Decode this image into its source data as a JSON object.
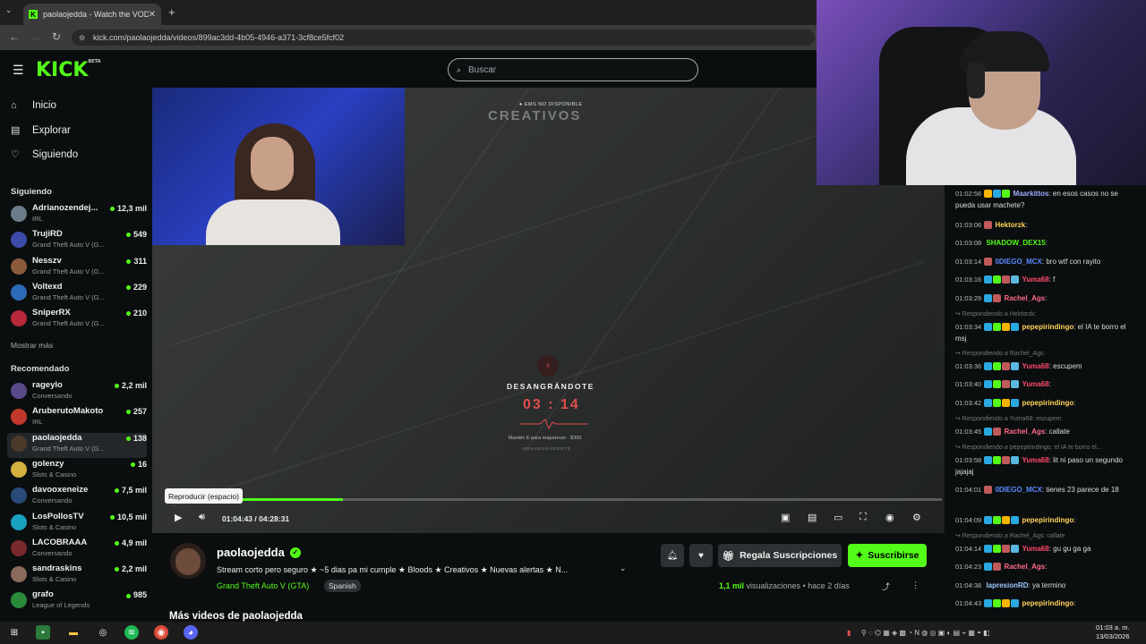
{
  "browser": {
    "tab_title": "paolaojedda - Watch the VOD o",
    "url": "kick.com/paolaojedda/videos/899ac3dd-4b05-4946-a371-3cf8ce5fcf02"
  },
  "header": {
    "logo": "KICK",
    "logo_beta": "BETA",
    "search_placeholder": "Buscar"
  },
  "sidebar": {
    "nav": [
      {
        "label": "Inicio",
        "icon": "home-icon"
      },
      {
        "label": "Explorar",
        "icon": "compass-icon"
      },
      {
        "label": "Siguiendo",
        "icon": "heart-icon"
      }
    ],
    "following_title": "Siguiendo",
    "following": [
      {
        "name": "Adrianozendej...",
        "category": "IRL",
        "viewers": "12,3 mil",
        "color": "#6d7c8a"
      },
      {
        "name": "TrujiRD",
        "category": "Grand Theft Auto V (G...",
        "viewers": "549",
        "color": "#3d4ca8"
      },
      {
        "name": "Nesszv",
        "category": "Grand Theft Auto V (G...",
        "viewers": "311",
        "color": "#8a5a3a"
      },
      {
        "name": "Voltexd",
        "category": "Grand Theft Auto V (G...",
        "viewers": "229",
        "color": "#2d6ab8"
      },
      {
        "name": "SniperRX",
        "category": "Grand Theft Auto V (G...",
        "viewers": "210",
        "color": "#b8283a"
      }
    ],
    "show_more": "Mostrar más",
    "recommended_title": "Recomendado",
    "recommended": [
      {
        "name": "rageylo",
        "category": "Conversando",
        "viewers": "2,2 mil",
        "color": "#5a4a8a"
      },
      {
        "name": "AruberutoMakoto",
        "category": "IRL",
        "viewers": "257",
        "color": "#c0392b"
      },
      {
        "name": "paolaojedda",
        "category": "Grand Theft Auto V (G...",
        "viewers": "138",
        "color": "#4a3a2a"
      },
      {
        "name": "golenzy",
        "category": "Slots & Casino",
        "viewers": "16",
        "color": "#d4b040"
      },
      {
        "name": "davooxeneize",
        "category": "Conversando",
        "viewers": "7,5 mil",
        "color": "#2a4a7a"
      },
      {
        "name": "LosPollosTV",
        "category": "Slots & Casino",
        "viewers": "10,5 mil",
        "color": "#1aa0c0"
      },
      {
        "name": "LACOBRAAA",
        "category": "Conversando",
        "viewers": "4,9 mil",
        "color": "#7a2a2a"
      },
      {
        "name": "sandraskins",
        "category": "Slots & Casino",
        "viewers": "2,2 mil",
        "color": "#8a6a5a"
      },
      {
        "name": "grafo",
        "category": "League of Legends",
        "viewers": "985",
        "color": "#2a8a3a"
      }
    ]
  },
  "video": {
    "ems_text": "● EMS NO DISPONIBLE",
    "watermark": "CREATIVOS",
    "bleed_title": "DESANGRÁNDOTE",
    "bleed_timer": "03 : 14",
    "hold_text": "Mantén E para reaparecer · $300",
    "bleed_sub": "DESANGRÁNDOTE",
    "tooltip": "Reproducir (espacio)",
    "time_current": "01:04:43",
    "time_total": "04:28:31",
    "progress": 0.228
  },
  "channel": {
    "name": "paolaojedda",
    "title": "Stream corto pero seguro ★ ~5 dias pa mi cumple ★ Bloods ★ Creativos ★ Nuevas alertas ★ N...",
    "game": "Grand Theft Auto V (GTA)",
    "language": "Spanish",
    "gift_label": "Regala Suscripciones",
    "subscribe_label": "Suscribirse",
    "views_count": "1,1 mil",
    "views_label": "visualizaciones",
    "ago": "hace 2 días",
    "more_videos": "Más videos de paolaojedda"
  },
  "chat": [
    {
      "type": "msg",
      "time": "01:02:56",
      "user": "Maarkittos",
      "color": "#a0a8ff",
      "text": ": en esos casos no se pueda usar machete?",
      "badges": [
        "#f5b400",
        "#2aa8e0",
        "#53fc18"
      ]
    },
    {
      "type": "msg",
      "time": "01:03:06",
      "user": "Hektorzk",
      "color": "#ffd35a",
      "text": ":",
      "badges": [
        "#c05a5a"
      ]
    },
    {
      "type": "msg",
      "time": "01:03:08",
      "user": "SHADOW_DEX15",
      "color": "#53fc18",
      "text": ":",
      "badges": []
    },
    {
      "type": "msg",
      "time": "01:03:14",
      "user": "0DIEGO_MCX",
      "color": "#5a8aff",
      "text": ": bro wtf con rayito",
      "badges": [
        "#c05a5a"
      ]
    },
    {
      "type": "msg",
      "time": "01:03:16",
      "user": "Yuma68",
      "color": "#ff4a6a",
      "text": ": f",
      "badges": [
        "#2aa8e0",
        "#53fc18",
        "#c05a5a",
        "#5ab8e0"
      ]
    },
    {
      "type": "msg",
      "time": "01:03:29",
      "user": "Rachel_Ags",
      "color": "#ff6a8a",
      "text": ":",
      "badges": [
        "#2aa8e0",
        "#c05a5a"
      ]
    },
    {
      "type": "reply",
      "text": "↪ Respondiendo a Hektorzk:"
    },
    {
      "type": "msg",
      "time": "01:03:34",
      "user": "pepepirindingo",
      "color": "#ffd35a",
      "text": ": el IA te borro el msj",
      "badges": [
        "#2aa8e0",
        "#53fc18",
        "#f5b400",
        "#2aa8e0"
      ]
    },
    {
      "type": "reply",
      "text": "↪ Respondiendo a Rachel_Ags:"
    },
    {
      "type": "msg",
      "time": "01:03:36",
      "user": "Yuma68",
      "color": "#ff4a6a",
      "text": ": escupem",
      "badges": [
        "#2aa8e0",
        "#53fc18",
        "#c05a5a",
        "#5ab8e0"
      ]
    },
    {
      "type": "msg",
      "time": "01:03:40",
      "user": "Yuma68",
      "color": "#ff4a6a",
      "text": ":",
      "badges": [
        "#2aa8e0",
        "#53fc18",
        "#c05a5a",
        "#5ab8e0"
      ]
    },
    {
      "type": "msg",
      "time": "01:03:42",
      "user": "pepepirindingo",
      "color": "#ffd35a",
      "text": ":",
      "badges": [
        "#2aa8e0",
        "#53fc18",
        "#f5b400",
        "#2aa8e0"
      ]
    },
    {
      "type": "reply",
      "text": "↪ Respondiendo a Yuma68: escupem"
    },
    {
      "type": "msg",
      "time": "01:03:45",
      "user": "Rachel_Ags",
      "color": "#ff6a8a",
      "text": ": callate",
      "badges": [
        "#2aa8e0",
        "#c05a5a"
      ]
    },
    {
      "type": "reply",
      "text": "↪ Respondiendo a pepepirindingo: el IA te borro el..."
    },
    {
      "type": "msg",
      "time": "01:03:58",
      "user": "Yuma68",
      "color": "#ff4a6a",
      "text": ": lit ni paso un segundo jajajaj",
      "badges": [
        "#2aa8e0",
        "#53fc18",
        "#c05a5a",
        "#5ab8e0"
      ]
    },
    {
      "type": "msg",
      "time": "01:04:01",
      "user": "0DIEGO_MCX",
      "color": "#5a8aff",
      "text": ": tienes 23 parece de 18",
      "badges": [
        "#c05a5a"
      ]
    },
    {
      "type": "msg",
      "time": "01:04:09",
      "user": "pepepirindingo",
      "color": "#ffd35a",
      "text": ":",
      "badges": [
        "#2aa8e0",
        "#53fc18",
        "#f5b400",
        "#2aa8e0"
      ]
    },
    {
      "type": "reply",
      "text": "↪ Respondiendo a Rachel_Ags: callate"
    },
    {
      "type": "msg",
      "time": "01:04:14",
      "user": "Yuma68",
      "color": "#ff4a6a",
      "text": ": gu gu ga ga",
      "badges": [
        "#2aa8e0",
        "#53fc18",
        "#c05a5a",
        "#5ab8e0"
      ]
    },
    {
      "type": "msg",
      "time": "01:04:23",
      "user": "Rachel_Ags",
      "color": "#ff6a8a",
      "text": ":",
      "badges": [
        "#2aa8e0",
        "#c05a5a"
      ]
    },
    {
      "type": "msg",
      "time": "01:04:38",
      "user": "lapresionRD",
      "color": "#a0c8ff",
      "text": ": ya termino",
      "badges": []
    },
    {
      "type": "msg",
      "time": "01:04:43",
      "user": "pepepirindingo",
      "color": "#ffd35a",
      "text": ":",
      "badges": [
        "#2aa8e0",
        "#53fc18",
        "#f5b400",
        "#2aa8e0"
      ]
    }
  ],
  "taskbar": {
    "time": "01:03 a. m.",
    "date": "13/03/2026"
  }
}
